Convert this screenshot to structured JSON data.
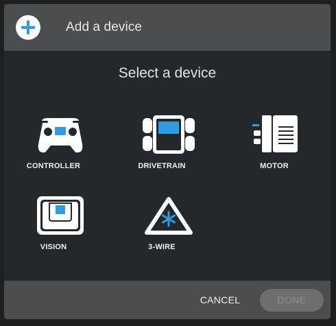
{
  "dialog": {
    "title": "Add a device",
    "add_icon": "plus-icon",
    "subtitle": "Select a device"
  },
  "devices": [
    {
      "label": "CONTROLLER",
      "icon": "controller-icon"
    },
    {
      "label": "DRIVETRAIN",
      "icon": "drivetrain-icon"
    },
    {
      "label": "MOTOR",
      "icon": "motor-icon"
    },
    {
      "label": "VISION",
      "icon": "vision-sensor-icon"
    },
    {
      "label": "3-WIRE",
      "icon": "three-wire-icon"
    }
  ],
  "footer": {
    "cancel_label": "CANCEL",
    "done_label": "DONE",
    "done_enabled": false
  },
  "colors": {
    "accent_blue": "#2f9be4",
    "header_bg": "#4b4d4f",
    "body_bg": "#25282a",
    "icon_white": "#ffffff"
  }
}
